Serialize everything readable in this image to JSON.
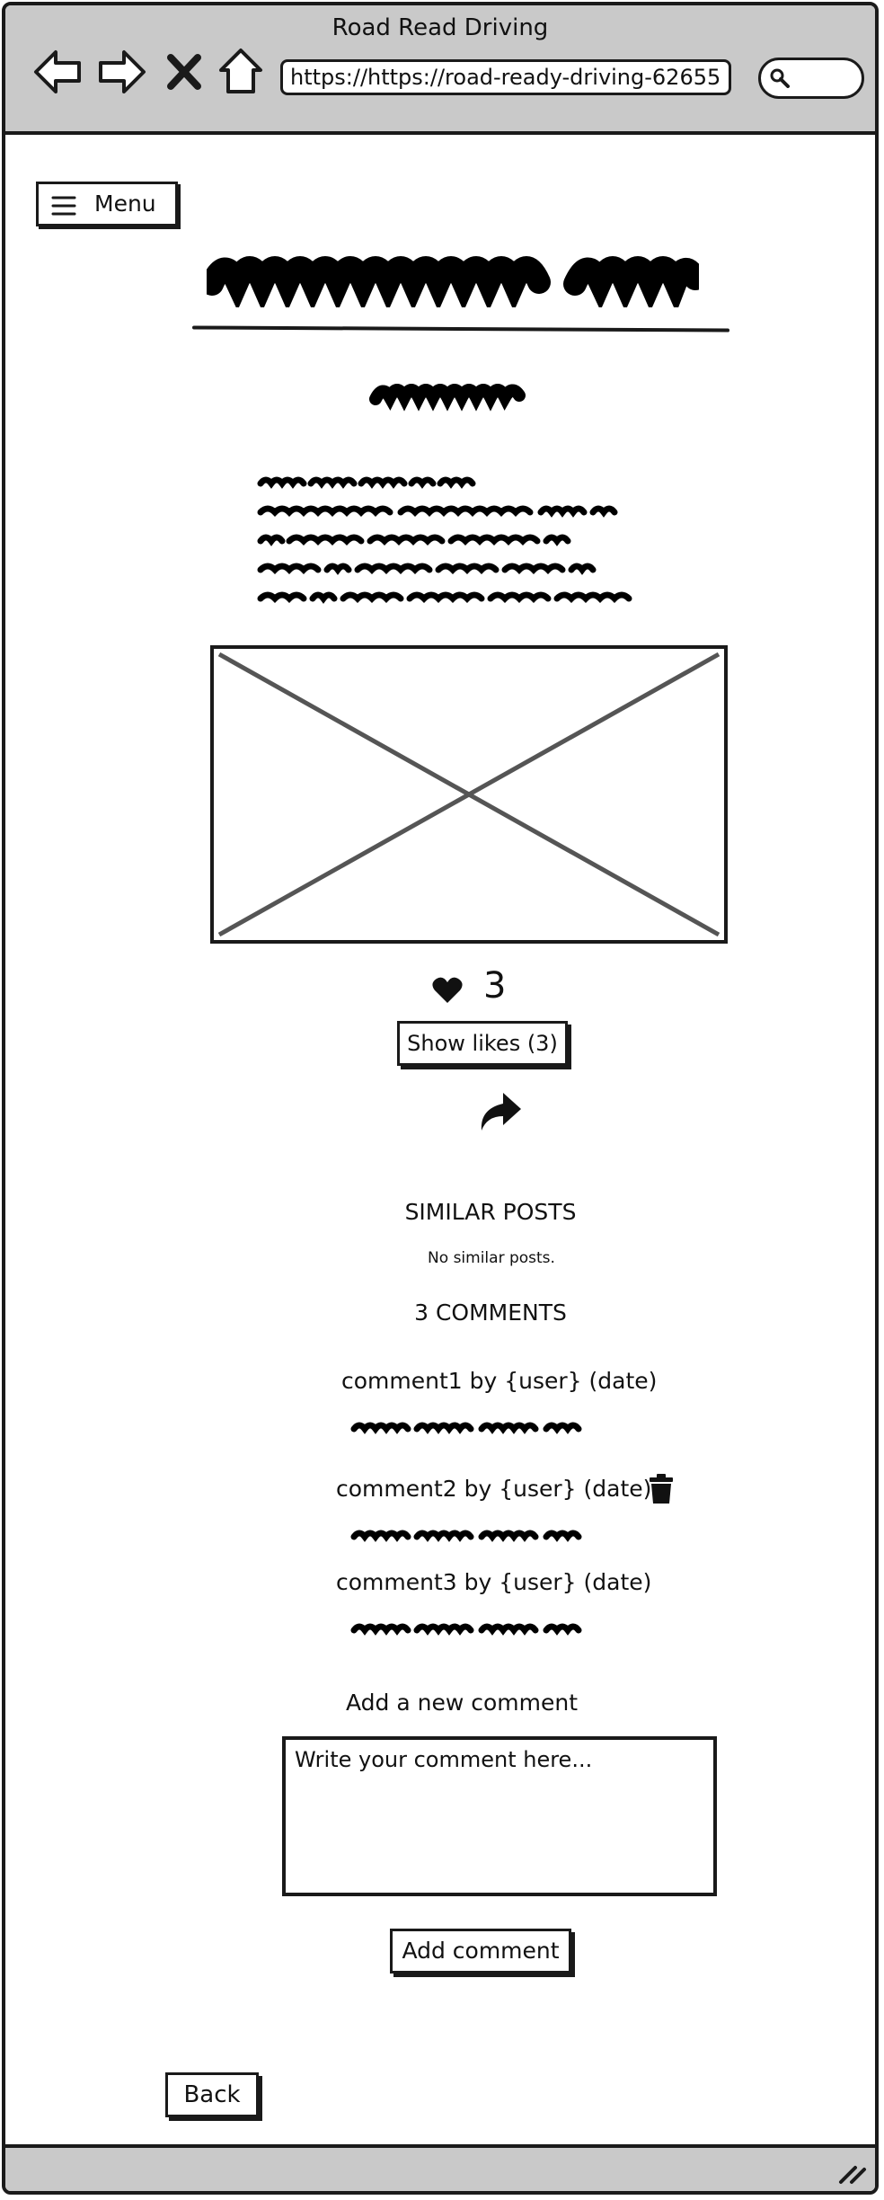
{
  "window": {
    "title": "Road Read Driving",
    "url": "https://https://road-ready-driving-62655"
  },
  "nav": {
    "back_icon": "arrow-left-icon",
    "forward_icon": "arrow-right-icon",
    "close_icon": "close-icon",
    "home_icon": "home-icon",
    "search_icon": "search-icon"
  },
  "menu": {
    "label": "Menu",
    "icon": "hamburger-icon"
  },
  "post": {
    "image_placeholder": "image-placeholder",
    "likes": {
      "icon": "heart-icon",
      "count": "3",
      "show_label": "Show likes (3)"
    },
    "share_icon": "share-icon"
  },
  "similar": {
    "title": "SIMILAR POSTS",
    "empty_text": "No similar posts."
  },
  "comments": {
    "title": "3 COMMENTS",
    "items": [
      {
        "header": "comment1 by {user} (date)",
        "deletable": false
      },
      {
        "header": "comment2 by {user} (date)",
        "deletable": true
      },
      {
        "header": "comment3 by {user} (date)",
        "deletable": false
      }
    ]
  },
  "new_comment": {
    "label": "Add a new comment",
    "placeholder": "Write your comment here...",
    "submit_label": "Add comment"
  },
  "footer": {
    "back_label": "Back"
  },
  "colors": {
    "chrome": "#c9c9c9",
    "ink": "#1a1a1a",
    "background": "#ffffff"
  }
}
